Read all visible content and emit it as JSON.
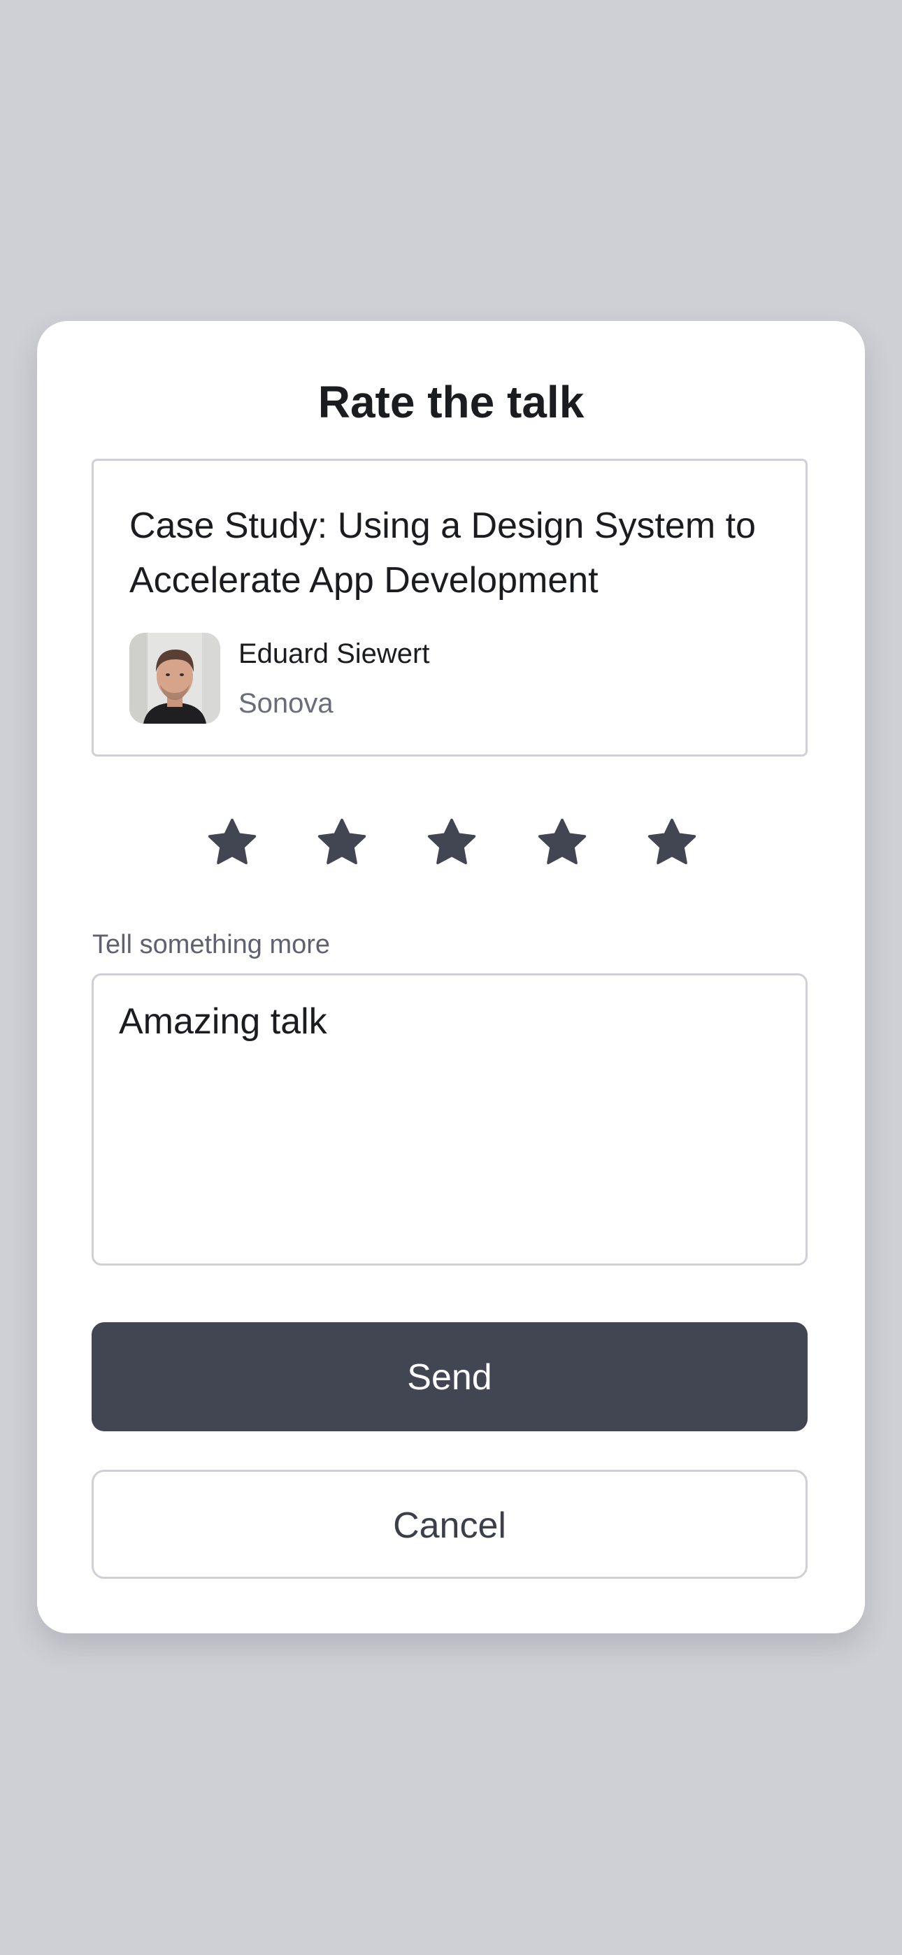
{
  "dialog": {
    "title": "Rate the talk"
  },
  "talk": {
    "title": "Case Study: Using a Design System to Accelerate App Development",
    "speaker_name": "Eduard Siewert",
    "speaker_company": "Sonova"
  },
  "rating": {
    "max": 5,
    "value": 5,
    "star_icon": "star-icon",
    "star_color": "#424552"
  },
  "feedback": {
    "label": "Tell something more",
    "value": "Amazing talk"
  },
  "actions": {
    "send_label": "Send",
    "cancel_label": "Cancel"
  },
  "colors": {
    "background": "#cfd0d5",
    "primary_button": "#424552",
    "border": "#cfcfd8"
  }
}
